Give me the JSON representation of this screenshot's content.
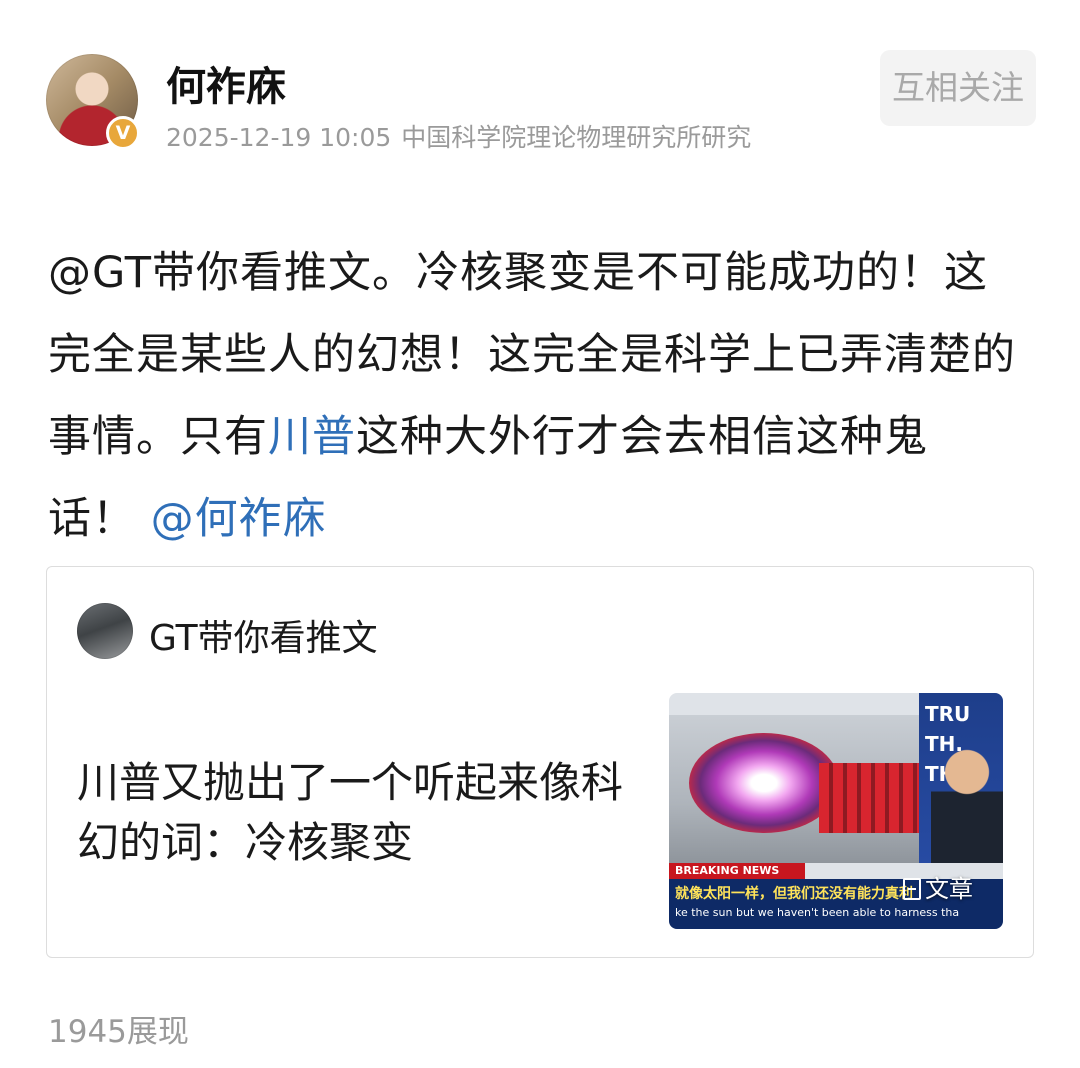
{
  "author": {
    "name": "何祚庥",
    "timestamp": "2025-12-19 10:05",
    "source": "中国科学院理论物理研究所研究",
    "verified_badge": "V"
  },
  "follow_button": {
    "label": "互相关注"
  },
  "post": {
    "segments": [
      {
        "text": "@GT带你看推文。冷核聚变是不可能成功的！这完全是某些人的幻想！这完全是科学上已弄清楚的事情。只有",
        "link": false
      },
      {
        "text": "川普",
        "link": true
      },
      {
        "text": "这种大外行才会去相信这种鬼话！",
        "link": false
      },
      {
        "text": "@何祚庥",
        "link": true
      }
    ]
  },
  "quoted": {
    "author": "GT带你看推文",
    "article_title": "川普又抛出了一个听起来像科幻的词：冷核聚变",
    "thumbnail": {
      "panel_text": "TRU\nTH.\nTH",
      "breaking": "BREAKING NEWS",
      "ticker_cn": "就像太阳一样，但我们还没有能力真利",
      "ticker_en": "ke the sun but we haven't been able to harness tha",
      "article_label": "文章",
      "article_icon": "document-icon"
    }
  },
  "stats": {
    "views": "1945展现"
  },
  "colors": {
    "link": "#2f6fb8",
    "meta_gray": "#9a9a9a",
    "badge": "#e8a73b"
  }
}
